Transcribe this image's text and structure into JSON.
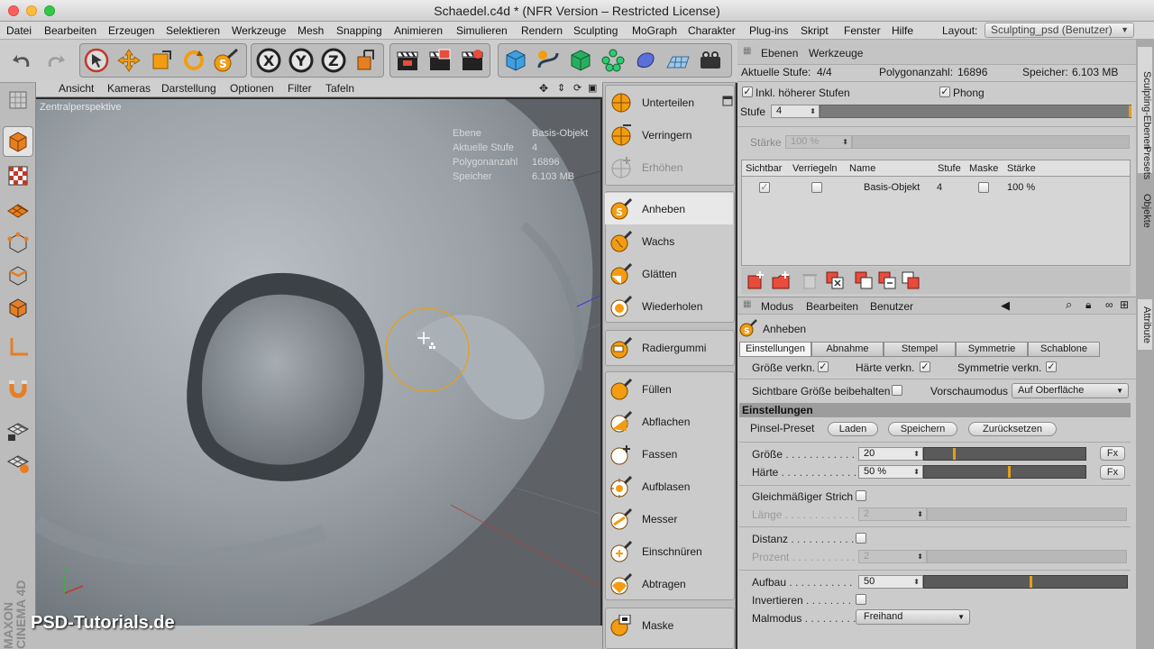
{
  "window": {
    "title": "Schaedel.c4d * (NFR Version – Restricted License)"
  },
  "menubar": {
    "items": [
      "Datei",
      "Bearbeiten",
      "Erzeugen",
      "Selektieren",
      "Werkzeuge",
      "Mesh",
      "Snapping",
      "Animieren",
      "Simulieren",
      "Rendern",
      "Sculpting",
      "MoGraph",
      "Charakter",
      "Plug-ins",
      "Skript",
      "Fenster",
      "Hilfe"
    ],
    "layout_label": "Layout:",
    "layout_value": "Sculpting_psd (Benutzer)"
  },
  "viewport": {
    "menu": [
      "Ansicht",
      "Kameras",
      "Darstellung",
      "Optionen",
      "Filter",
      "Tafeln"
    ],
    "camera_label": "Zentralperspektive",
    "hud": {
      "ebene_label": "Ebene",
      "ebene_value": "Basis-Objekt",
      "stufe_label": "Aktuelle Stufe",
      "stufe_value": "4",
      "poly_label": "Polygonanzahl",
      "poly_value": "16896",
      "speicher_label": "Speicher",
      "speicher_value": "6.103 MB"
    },
    "axis_y": "Y",
    "watermark": "PSD-Tutorials.de",
    "brand": "MAXON CINEMA 4D"
  },
  "brushes": {
    "group1": [
      "Unterteilen",
      "Verringern",
      "Erhöhen"
    ],
    "group2": [
      "Anheben",
      "Wachs",
      "Glätten",
      "Wiederholen"
    ],
    "group3": [
      "Radiergummi"
    ],
    "group4": [
      "Füllen",
      "Abflachen",
      "Fassen",
      "Aufblasen",
      "Messer",
      "Einschnüren",
      "Abtragen"
    ],
    "group5": [
      "Maske"
    ],
    "selected": "Anheben"
  },
  "layers_panel": {
    "tabs": [
      "Ebenen",
      "Werkzeuge"
    ],
    "stufe_info_label": "Aktuelle Stufe:",
    "stufe_info_value": "4/4",
    "poly_label": "Polygonanzahl:",
    "poly_value": "16896",
    "mem_label": "Speicher:",
    "mem_value": "6.103 MB",
    "inkl_label": "Inkl. höherer Stufen",
    "phong_label": "Phong",
    "stufe_label": "Stufe",
    "stufe_value": "4",
    "staerke_label": "Stärke",
    "staerke_value": "100 %",
    "columns": [
      "Sichtbar",
      "Verriegeln",
      "Name",
      "Stufe",
      "Maske",
      "Stärke"
    ],
    "rows": [
      {
        "name": "Basis-Objekt",
        "stufe": "4",
        "staerke": "100 %"
      }
    ]
  },
  "attributes": {
    "menu": [
      "Modus",
      "Bearbeiten",
      "Benutzer"
    ],
    "tool_name": "Anheben",
    "tabs": [
      "Einstellungen",
      "Abnahme",
      "Stempel",
      "Symmetrie",
      "Schablone"
    ],
    "active_tab": "Einstellungen",
    "groesse_verkn": "Größe verkn.",
    "haerte_verkn": "Härte verkn.",
    "symmetrie_verkn": "Symmetrie verkn.",
    "sichtbare_groesse": "Sichtbare Größe beibehalten",
    "vorschau_label": "Vorschaumodus",
    "vorschau_value": "Auf Oberfläche",
    "section": "Einstellungen",
    "preset_label": "Pinsel-Preset",
    "preset_buttons": [
      "Laden",
      "Speichern",
      "Zurücksetzen"
    ],
    "groesse_label": "Größe",
    "groesse_value": "20",
    "groesse_level": 0.2,
    "haerte_label": "Härte",
    "haerte_value": "50 %",
    "haerte_level": 0.5,
    "fx_label": "Fx",
    "gleich_label": "Gleichmäßiger Strich",
    "laenge_label": "Länge",
    "laenge_value": "2",
    "distanz_label": "Distanz",
    "prozent_label": "Prozent",
    "prozent_value": "2",
    "aufbau_label": "Aufbau",
    "aufbau_value": "50",
    "aufbau_level": 0.5,
    "invertieren_label": "Invertieren",
    "malmodus_label": "Malmodus",
    "malmodus_value": "Freihand"
  },
  "side_tabs": [
    "Sculpting-Ebenen",
    "Presets",
    "Objekte",
    "Attribute"
  ],
  "colors": {
    "accent": "#e3a01a",
    "viewport_bg": "#5e6266"
  }
}
